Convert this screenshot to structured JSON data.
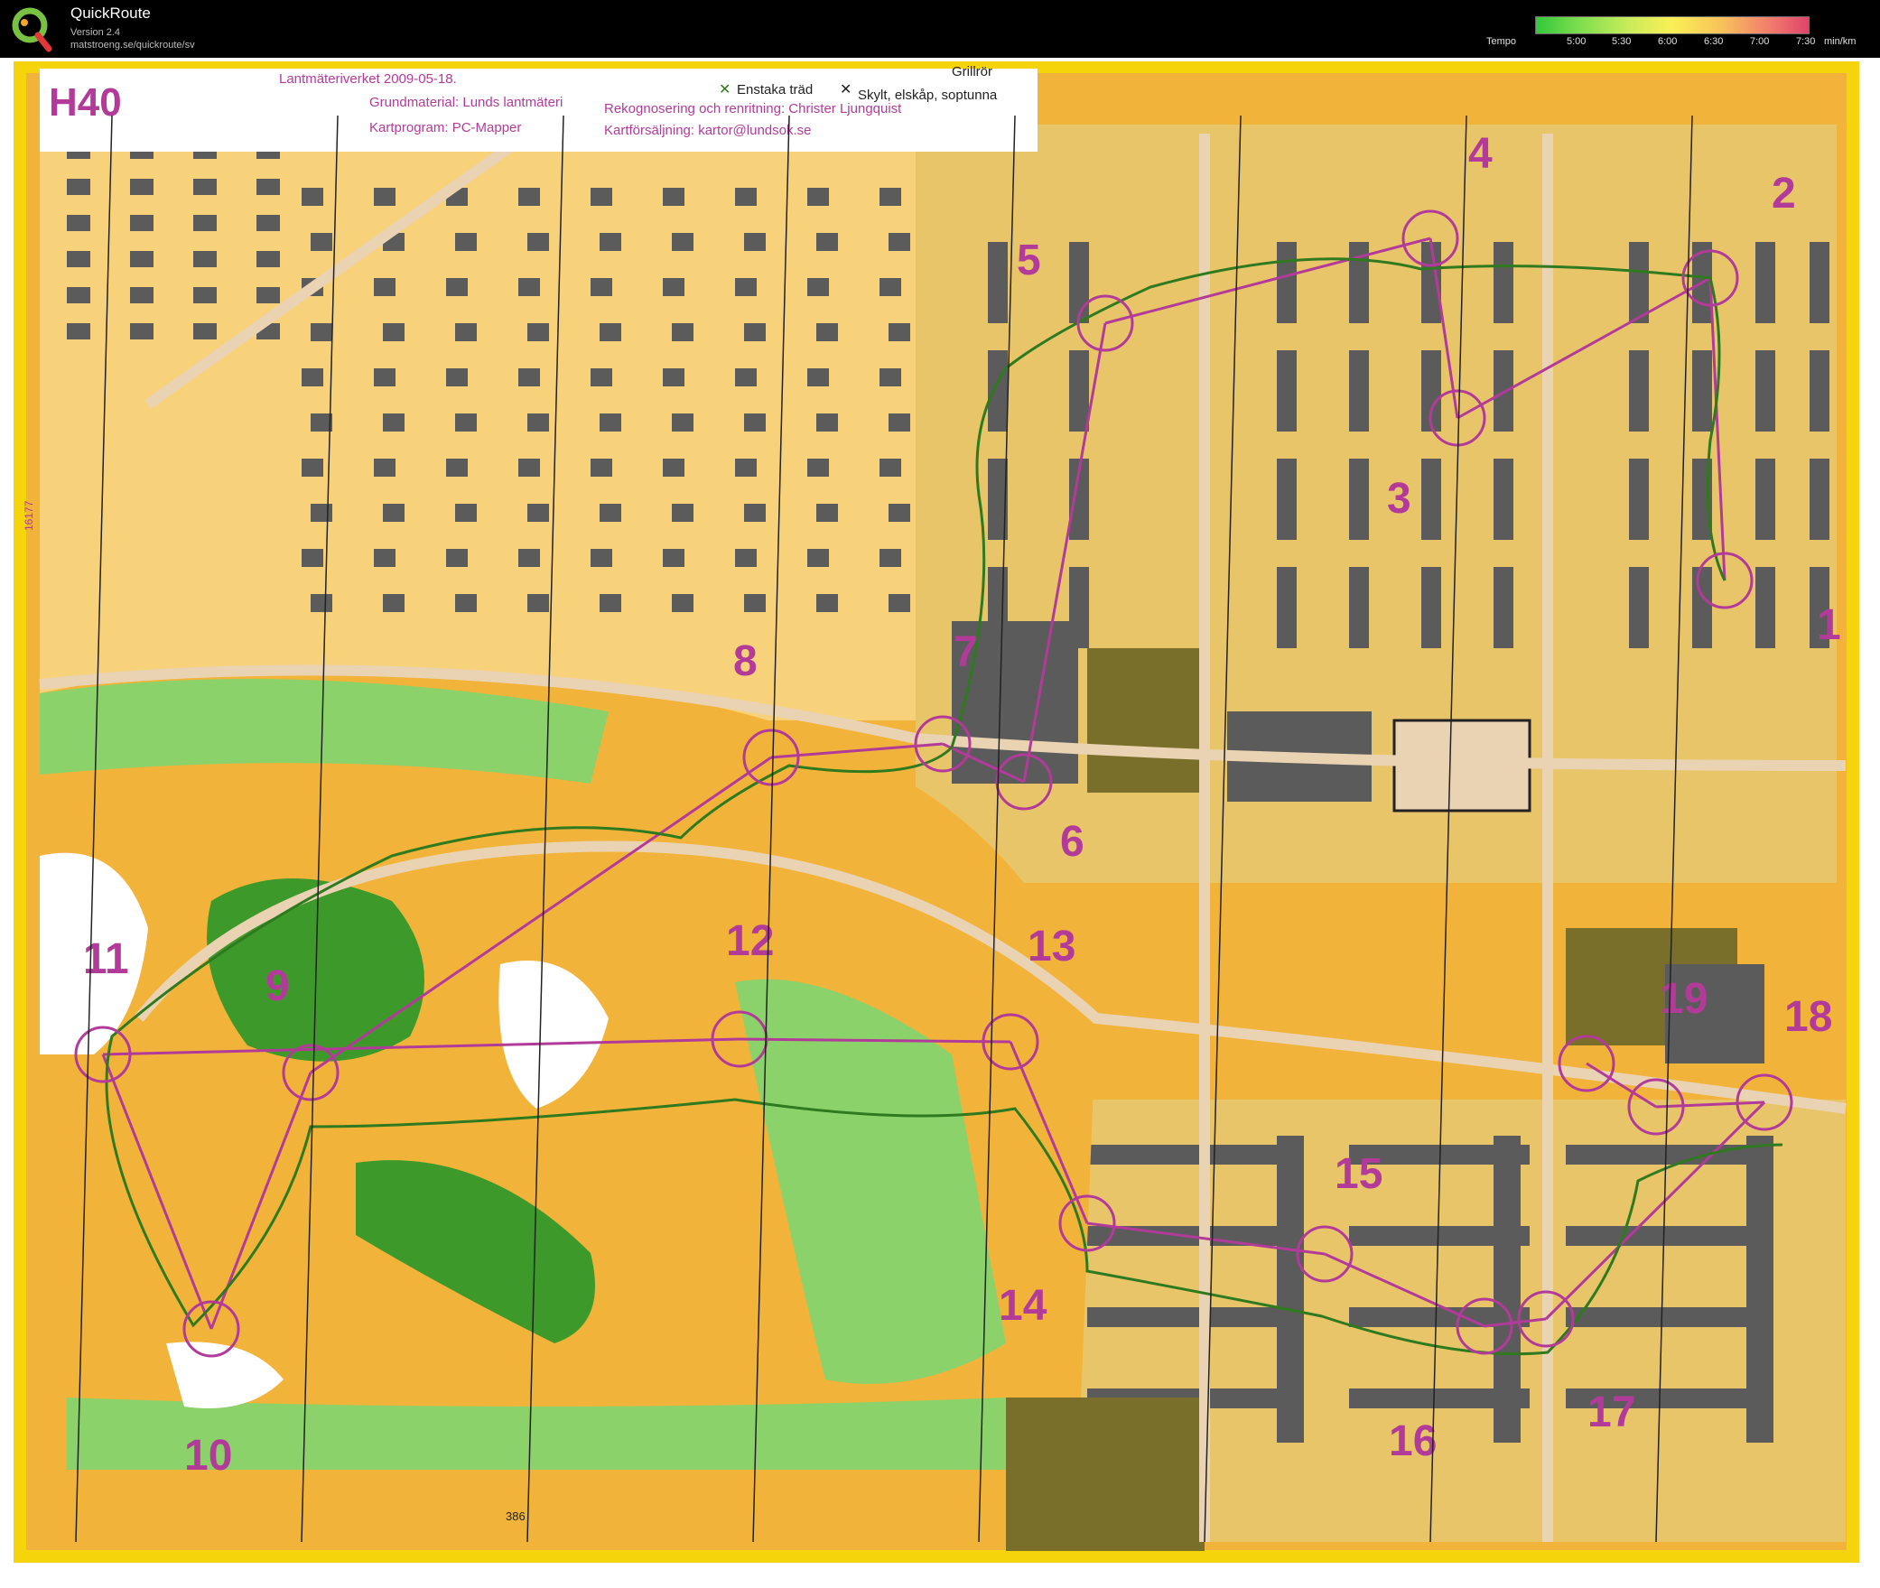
{
  "app": {
    "title": "QuickRoute",
    "version": "Version 2.4",
    "url": "matstroeng.se/quickroute/sv"
  },
  "tempo": {
    "label": "Tempo",
    "ticks": [
      "5:00",
      "5:30",
      "6:00",
      "6:30",
      "7:00",
      "7:30"
    ],
    "unit": "min/km"
  },
  "map": {
    "class_label": "H40",
    "legend": {
      "line1": "Lantmäteriverket 2009-05-18.",
      "line2": "Grundmaterial: Lunds lantmäteri",
      "line3": "Kartprogram: PC-Mapper",
      "line4": "Rekognosering och renritning: Christer Ljungquist",
      "line5": "Kartförsäljning: kartor@lundsok.se",
      "symbol1": "Enstaka träd",
      "symbol2": "Skylt, elskåp, soptunna",
      "symbol3": "Grillrör"
    },
    "grid_label_left": "16177",
    "grid_label_bottom": "386",
    "controls": [
      "1",
      "2",
      "3",
      "4",
      "5",
      "6",
      "7",
      "8",
      "9",
      "10",
      "11",
      "12",
      "13",
      "14",
      "15",
      "16",
      "17",
      "18",
      "19"
    ],
    "colors": {
      "open_land": "#f2b33a",
      "rough_open": "#f7d27a",
      "forest_green": "#8cd26a",
      "dense_green": "#3d9a2a",
      "building": "#5b5b5b",
      "course": "#b23b9a",
      "route": "#2f7a1f",
      "road": "#ead3b2",
      "frame_yellow": "#f5d40c"
    }
  }
}
